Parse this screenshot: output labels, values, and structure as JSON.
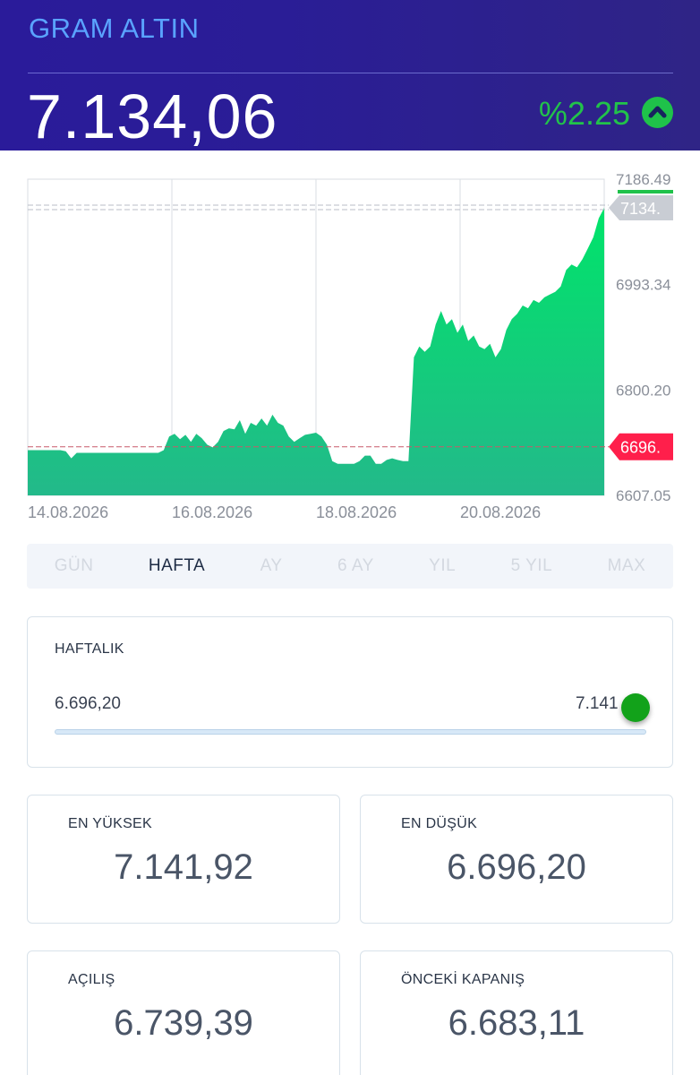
{
  "header": {
    "title": "GRAM ALTIN",
    "price": "7.134,06",
    "change": "%2.25"
  },
  "chart_data": {
    "type": "area",
    "x_labels": [
      "14.08.2026",
      "16.08.2026",
      "18.08.2026",
      "20.08.2026"
    ],
    "y_ticks": [
      "7186.49",
      "6993.34",
      "6800.20",
      "6607.05"
    ],
    "current_value_tag": "7134.",
    "low_value_tag": "6696.",
    "ylim": [
      6607.05,
      7186.49
    ],
    "current_value": 7134.06,
    "low_value": 6696.2,
    "series": [
      {
        "values": [
          6690,
          6690,
          6690,
          6690,
          6690,
          6690,
          6690,
          6688,
          6675,
          6685,
          6685,
          6685,
          6685,
          6685,
          6685,
          6685,
          6685,
          6685,
          6685,
          6685,
          6685,
          6685,
          6685,
          6685,
          6685,
          6690,
          6715,
          6720,
          6710,
          6718,
          6705,
          6720,
          6712,
          6700,
          6695,
          6705,
          6725,
          6730,
          6728,
          6745,
          6720,
          6740,
          6735,
          6748,
          6735,
          6755,
          6740,
          6735,
          6715,
          6705,
          6712,
          6718,
          6720,
          6722,
          6715,
          6700,
          6670,
          6665,
          6665,
          6665,
          6665,
          6670,
          6680,
          6680,
          6665,
          6665,
          6672,
          6675,
          6672,
          6670,
          6670,
          6860,
          6880,
          6870,
          6880,
          6920,
          6945,
          6920,
          6930,
          6905,
          6920,
          6890,
          6900,
          6880,
          6875,
          6885,
          6860,
          6875,
          6910,
          6930,
          6940,
          6955,
          6950,
          6965,
          6960,
          6970,
          6975,
          6980,
          6990,
          7020,
          7030,
          7025,
          7040,
          7060,
          7080,
          7115,
          7134
        ]
      }
    ]
  },
  "tabs": [
    "GÜN",
    "HAFTA",
    "AY",
    "6 AY",
    "YIL",
    "5 YIL",
    "MAX"
  ],
  "range": {
    "label": "HAFTALIK",
    "low": "6.696,20",
    "high": "7.141",
    "min": 6696.2,
    "max": 7141.92,
    "value": 7134.06
  },
  "stats": {
    "high_label": "EN YÜKSEK",
    "high_value": "7.141,92",
    "low_label": "EN DÜŞÜK",
    "low_value": "6.696,20",
    "open_label": "AÇILIŞ",
    "open_value": "6.739,39",
    "prev_close_label": "ÖNCEKİ KAPANIŞ",
    "prev_close_value": "6.683,11"
  },
  "colors": {
    "header_bg": "#2a1b9a",
    "title": "#5aa3ff",
    "positive": "#22c34a",
    "area_top": "#00e46a",
    "area_bottom": "#23b98a",
    "low_tag": "#ff1f4b",
    "current_tag": "#c9cdd4",
    "knob": "#12a21a"
  }
}
